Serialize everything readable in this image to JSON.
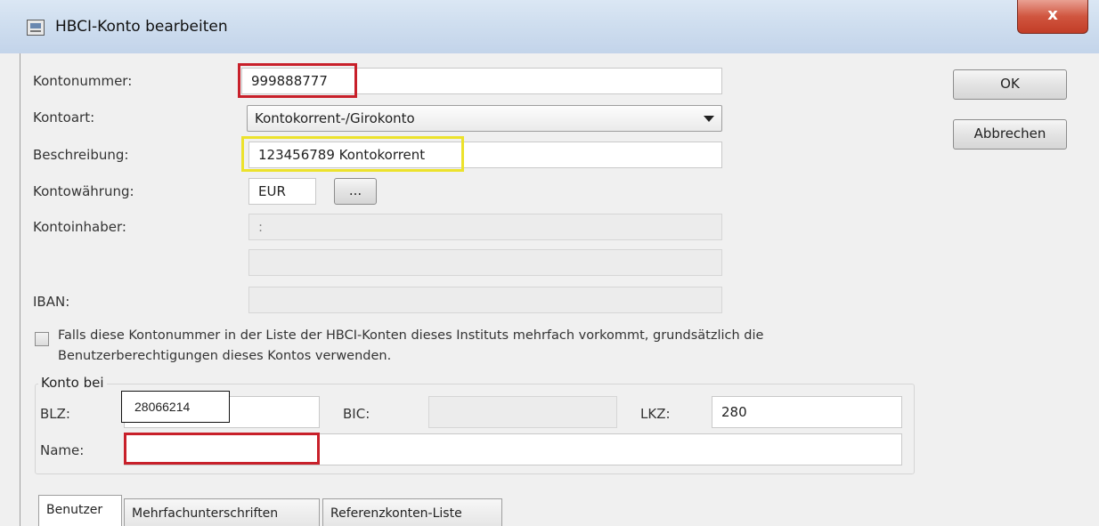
{
  "window": {
    "title": "HBCI-Konto bearbeiten",
    "close_symbol": "x"
  },
  "buttons": {
    "ok": "OK",
    "cancel": "Abbrechen",
    "currency_more": "..."
  },
  "form": {
    "kontonummer_label": "Kontonummer:",
    "kontonummer_value": "999888777",
    "kontoart_label": "Kontoart:",
    "kontoart_value": "Kontokorrent-/Girokonto",
    "beschreibung_label": "Beschreibung:",
    "beschreibung_value": "123456789 Kontokorrent",
    "kontowaehrung_label": "Kontowährung:",
    "kontowaehrung_value": "EUR",
    "kontoinhaber_label": "Kontoinhaber:",
    "kontoinhaber_value": ":",
    "iban_label": "IBAN:",
    "checkbox_text_line1": "Falls diese Kontonummer in der Liste der HBCI-Konten dieses Instituts mehrfach vorkommt, grundsätzlich die",
    "checkbox_text_line2": "Benutzerberechtigungen dieses Kontos verwenden.",
    "checkbox_checked": false
  },
  "konto_bei": {
    "group_title": "Konto bei",
    "blz_label": "BLZ:",
    "blz_value": "28066214",
    "bic_label": "BIC:",
    "lkz_label": "LKZ:",
    "lkz_value": "280",
    "name_label": "Name:"
  },
  "tabs": [
    {
      "label": "Benutzer",
      "active": true
    },
    {
      "label": "Mehrfachunterschriften",
      "active": false
    },
    {
      "label": "Referenzkonten-Liste",
      "active": false
    }
  ],
  "colors": {
    "highlight_red": "#c8202a",
    "highlight_yellow": "#ece22c"
  },
  "icons": {
    "title": "hbci-account-icon",
    "close": "close-icon",
    "dropdown": "chevron-down-icon"
  }
}
